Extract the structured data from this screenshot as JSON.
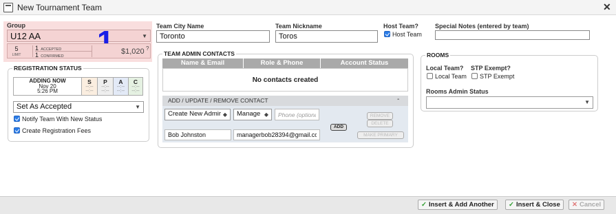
{
  "window": {
    "title": "New Tournament Team"
  },
  "group": {
    "label": "Group",
    "selected": "U12 AA",
    "badge_number": "1",
    "limit_value": "5",
    "limit_label": "LIMIT",
    "accepted_count": "1",
    "accepted_label": "ACCEPTED",
    "confirmed_count": "1",
    "confirmed_label": "CONFIRMED",
    "price": "$1,020",
    "help": "?"
  },
  "registration": {
    "legend": "REGISTRATION STATUS",
    "adding_title": "ADDING NOW",
    "adding_date": "Nov 20",
    "adding_time": "5:26 PM",
    "columns": [
      {
        "code": "S",
        "value": "--:--",
        "color": "#fbeee0"
      },
      {
        "code": "P",
        "value": "--:--",
        "color": "#eeeeee"
      },
      {
        "code": "A",
        "value": "--:--",
        "color": "#e3eaf7"
      },
      {
        "code": "C",
        "value": "--:--",
        "color": "#e5f1e2"
      }
    ],
    "status_select": "Set As Accepted",
    "notify_label": "Notify Team With New Status",
    "notify_checked": true,
    "fees_label": "Create Registration Fees",
    "fees_checked": true
  },
  "fields": {
    "city_label": "Team City Name",
    "city_value": "Toronto",
    "nickname_label": "Team Nickname",
    "nickname_value": "Toros",
    "host_label": "Host Team?",
    "host_check_label": "Host Team",
    "host_checked": true,
    "notes_label": "Special Notes (entered by team)",
    "notes_value": ""
  },
  "contacts": {
    "legend": "TEAM ADMIN CONTACTS",
    "columns": [
      "Name & Email",
      "Role & Phone",
      "Account Status"
    ],
    "empty_text": "No contacts created",
    "add_header": "ADD / UPDATE / REMOVE CONTACT",
    "collapse": "-",
    "mode_select": "Create New Admir",
    "role_select": "Manage",
    "phone_placeholder": "Phone (optional)",
    "name_value": "Bob Johnston",
    "email_value": "managerbob28394@gmail.cor",
    "add_label": "ADD",
    "remove_label": "REMOVE",
    "delete_label": "DELETE",
    "primary_label": "MAKE PRIMARY"
  },
  "rooms": {
    "legend": "ROOMS",
    "local_label": "Local Team?",
    "local_check": "Local Team",
    "local_checked": false,
    "stp_label": "STP Exempt?",
    "stp_check": "STP Exempt",
    "stp_checked": false,
    "admin_status_label": "Rooms Admin Status",
    "admin_status_value": ""
  },
  "footer": {
    "insert_add_label": "Insert & Add Another",
    "insert_close_label": "Insert & Close",
    "cancel_label": "Cancel"
  },
  "colors": {
    "group_bg": "#f9dede",
    "accent_number": "#1a1fe6",
    "checkbox": "#2b7de9",
    "ok_icon": "#2e9d2e"
  },
  "icons": {
    "window": "window-icon",
    "close": "close-icon",
    "dropdown": "chevron-down-icon",
    "check": "check-icon",
    "cancel": "x-icon"
  }
}
